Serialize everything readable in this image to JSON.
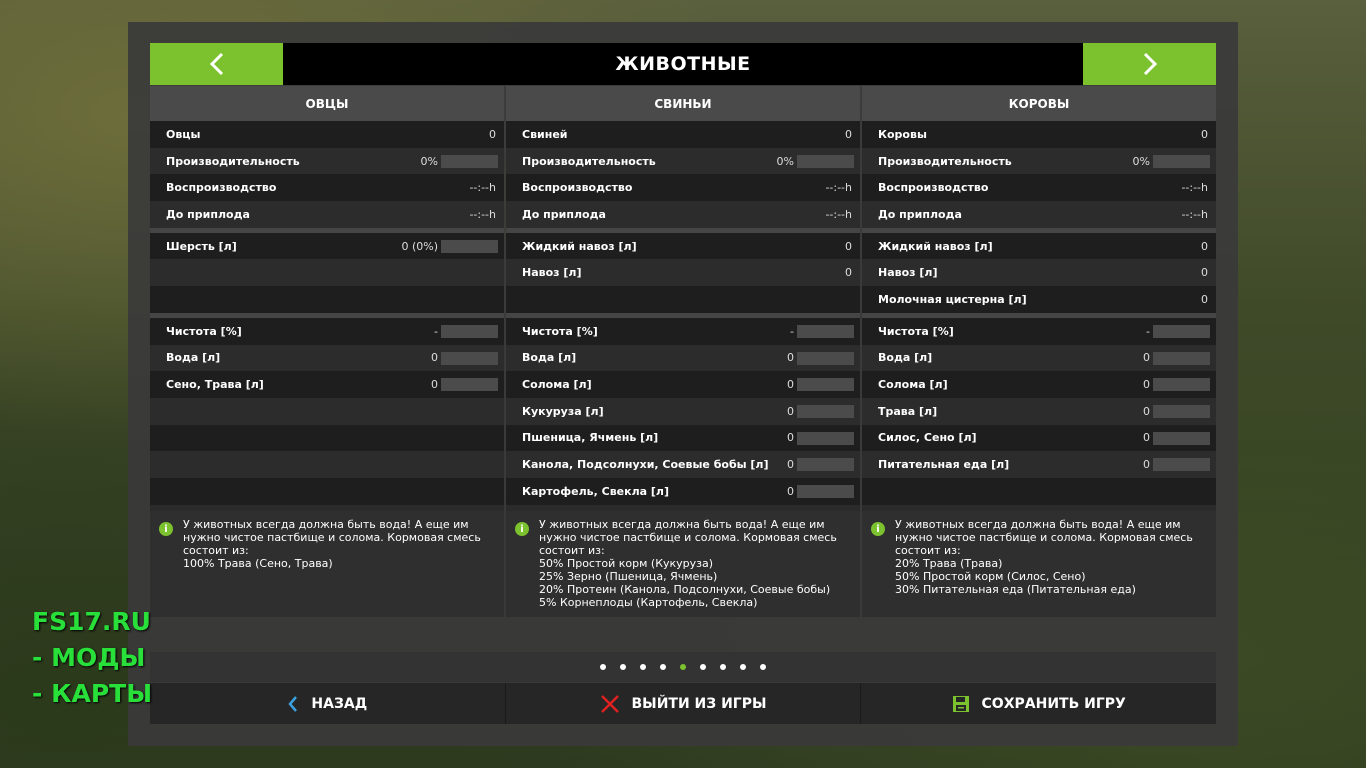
{
  "header": {
    "title": "ЖИВОТНЫЕ"
  },
  "columns": [
    {
      "name": "ОВЦЫ",
      "groups": [
        [
          {
            "label": "Овцы",
            "value": "0",
            "bar": false
          },
          {
            "label": "Производительность",
            "value": "0%",
            "bar": true
          },
          {
            "label": "Воспроизводство",
            "value": "--:--h",
            "bar": false
          },
          {
            "label": "До приплода",
            "value": "--:--h",
            "bar": false
          }
        ],
        [
          {
            "label": "Шерсть [л]",
            "value": "0 (0%)",
            "bar": true
          },
          {
            "label": "",
            "value": "",
            "bar": false
          },
          {
            "label": "",
            "value": "",
            "bar": false
          }
        ],
        [
          {
            "label": "Чистота [%]",
            "value": "-",
            "bar": true
          },
          {
            "label": "Вода [л]",
            "value": "0",
            "bar": true
          },
          {
            "label": "Сено, Трава [л]",
            "value": "0",
            "bar": true
          },
          {
            "label": "",
            "value": "",
            "bar": false
          },
          {
            "label": "",
            "value": "",
            "bar": false
          },
          {
            "label": "",
            "value": "",
            "bar": false
          },
          {
            "label": "",
            "value": "",
            "bar": false
          }
        ]
      ],
      "info": "У животных всегда должна быть вода! А еще им нужно чистое пастбище и солома. Кормовая смесь состоит из:\n100% Трава (Сено, Трава)"
    },
    {
      "name": "СВИНЬИ",
      "groups": [
        [
          {
            "label": "Свиней",
            "value": "0",
            "bar": false
          },
          {
            "label": "Производительность",
            "value": "0%",
            "bar": true
          },
          {
            "label": "Воспроизводство",
            "value": "--:--h",
            "bar": false
          },
          {
            "label": "До приплода",
            "value": "--:--h",
            "bar": false
          }
        ],
        [
          {
            "label": "Жидкий навоз [л]",
            "value": "0",
            "bar": false
          },
          {
            "label": "Навоз [л]",
            "value": "0",
            "bar": false
          },
          {
            "label": "",
            "value": "",
            "bar": false
          }
        ],
        [
          {
            "label": "Чистота [%]",
            "value": "-",
            "bar": true
          },
          {
            "label": "Вода [л]",
            "value": "0",
            "bar": true
          },
          {
            "label": "Солома [л]",
            "value": "0",
            "bar": true
          },
          {
            "label": "Кукуруза [л]",
            "value": "0",
            "bar": true
          },
          {
            "label": "Пшеница, Ячмень [л]",
            "value": "0",
            "bar": true
          },
          {
            "label": "Канола, Подсолнухи, Соевые бобы [л]",
            "value": "0",
            "bar": true
          },
          {
            "label": "Картофель, Свекла [л]",
            "value": "0",
            "bar": true
          }
        ]
      ],
      "info": "У животных всегда должна быть вода! А еще им нужно чистое пастбище и солома. Кормовая смесь состоит из:\n50% Простой корм (Кукуруза)\n25% Зерно (Пшеница, Ячмень)\n20% Протеин (Канола, Подсолнухи, Соевые бобы)\n5% Корнеплоды (Картофель, Свекла)"
    },
    {
      "name": "КОРОВЫ",
      "groups": [
        [
          {
            "label": "Коровы",
            "value": "0",
            "bar": false
          },
          {
            "label": "Производительность",
            "value": "0%",
            "bar": true
          },
          {
            "label": "Воспроизводство",
            "value": "--:--h",
            "bar": false
          },
          {
            "label": "До приплода",
            "value": "--:--h",
            "bar": false
          }
        ],
        [
          {
            "label": "Жидкий навоз [л]",
            "value": "0",
            "bar": false
          },
          {
            "label": "Навоз [л]",
            "value": "0",
            "bar": false
          },
          {
            "label": "Молочная цистерна [л]",
            "value": "0",
            "bar": false
          }
        ],
        [
          {
            "label": "Чистота [%]",
            "value": "-",
            "bar": true
          },
          {
            "label": "Вода [л]",
            "value": "0",
            "bar": true
          },
          {
            "label": "Солома [л]",
            "value": "0",
            "bar": true
          },
          {
            "label": "Трава [л]",
            "value": "0",
            "bar": true
          },
          {
            "label": "Силос, Сено [л]",
            "value": "0",
            "bar": true
          },
          {
            "label": "Питательная еда [л]",
            "value": "0",
            "bar": true
          },
          {
            "label": "",
            "value": "",
            "bar": false
          }
        ]
      ],
      "info": "У животных всегда должна быть вода! А еще им нужно чистое пастбище и солома. Кормовая смесь состоит из:\n20% Трава (Трава)\n50% Простой корм (Силос, Сено)\n30% Питательная еда (Питательная еда)"
    }
  ],
  "pagination": {
    "count": 9,
    "active": 4
  },
  "footer": {
    "back_label": "НАЗАД",
    "quit_label": "ВЫЙТИ ИЗ ИГРЫ",
    "save_label": "СОХРАНИТЬ ИГРУ"
  },
  "watermark": [
    "FS17.RU",
    " - МОДЫ",
    " - КАРТЫ"
  ],
  "colors": {
    "accent": "#7cc22f",
    "watermark": "#29e03a",
    "quit": "#e02020",
    "back": "#3aa0e0"
  }
}
